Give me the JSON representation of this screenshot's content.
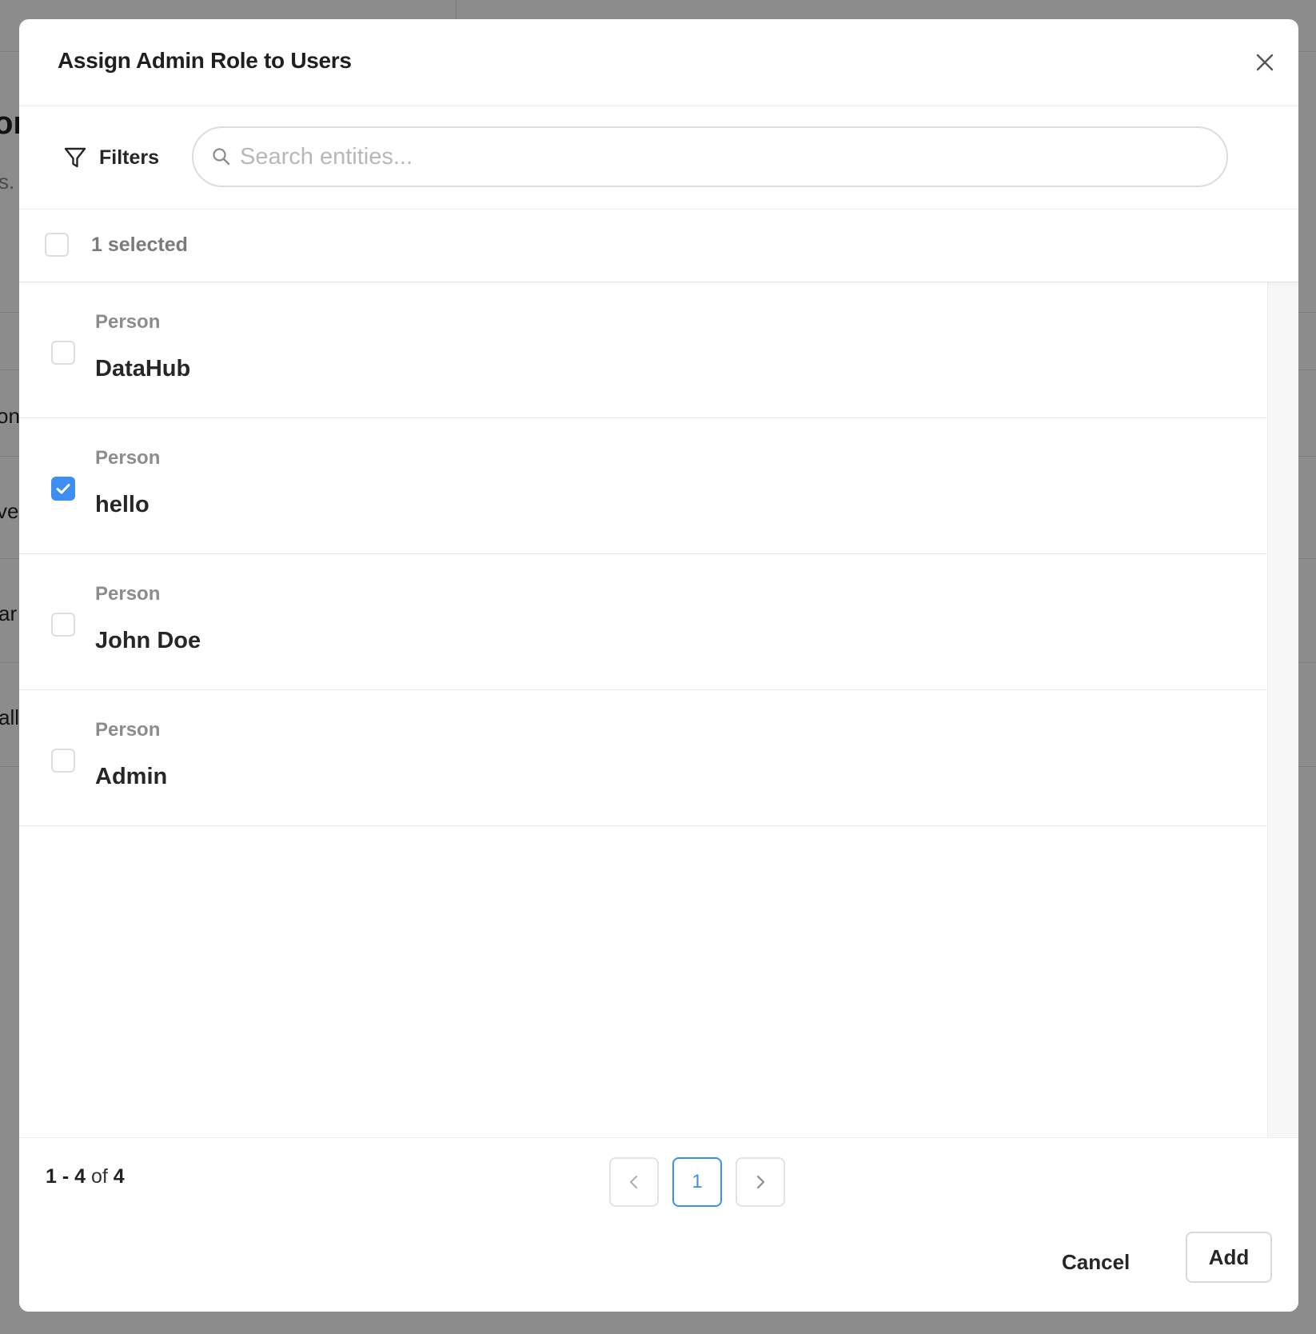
{
  "background": {
    "fragments": [
      "or",
      "s. ",
      "on",
      "ve",
      "ar",
      "all"
    ]
  },
  "modal": {
    "title": "Assign Admin Role to Users",
    "close_icon": "close-icon"
  },
  "toolbar": {
    "filters_label": "Filters",
    "filter_icon": "funnel-icon",
    "search": {
      "placeholder": "Search entities...",
      "value": "",
      "icon": "search-icon"
    }
  },
  "selection": {
    "all_checked": false,
    "selected_text": "1 selected"
  },
  "entities": [
    {
      "type": "Person",
      "name": "DataHub",
      "checked": false
    },
    {
      "type": "Person",
      "name": "hello",
      "checked": true
    },
    {
      "type": "Person",
      "name": "John Doe",
      "checked": false
    },
    {
      "type": "Person",
      "name": "Admin",
      "checked": false
    }
  ],
  "pagination": {
    "range_start": "1",
    "range_sep": " - ",
    "range_end": "4",
    "of_text": " of ",
    "total": "4",
    "current_page": "1",
    "prev_icon": "chevron-left-icon",
    "next_icon": "chevron-right-icon"
  },
  "footer": {
    "cancel_label": "Cancel",
    "add_label": "Add"
  },
  "colors": {
    "accent": "#3d8ef0",
    "overlay": "#737373"
  }
}
